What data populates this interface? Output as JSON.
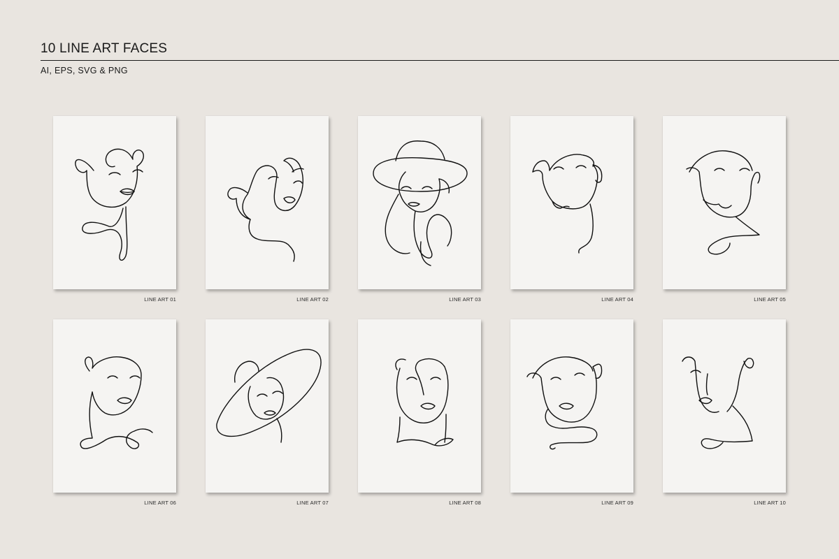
{
  "header": {
    "title": "10 LINE ART FACES",
    "subtitle": "AI, EPS, SVG & PNG"
  },
  "cards": [
    {
      "label": "LINE ART 01",
      "art": "face-01"
    },
    {
      "label": "LINE ART 02",
      "art": "face-02"
    },
    {
      "label": "LINE ART 03",
      "art": "face-03-hat"
    },
    {
      "label": "LINE ART 04",
      "art": "face-04"
    },
    {
      "label": "LINE ART 05",
      "art": "face-05"
    },
    {
      "label": "LINE ART 06",
      "art": "face-06"
    },
    {
      "label": "LINE ART 07",
      "art": "face-07-hat"
    },
    {
      "label": "LINE ART 08",
      "art": "face-08"
    },
    {
      "label": "LINE ART 09",
      "art": "face-09"
    },
    {
      "label": "LINE ART 10",
      "art": "face-10"
    }
  ],
  "colors": {
    "background": "#e9e5e0",
    "card": "#f5f4f2",
    "ink": "#111111"
  }
}
